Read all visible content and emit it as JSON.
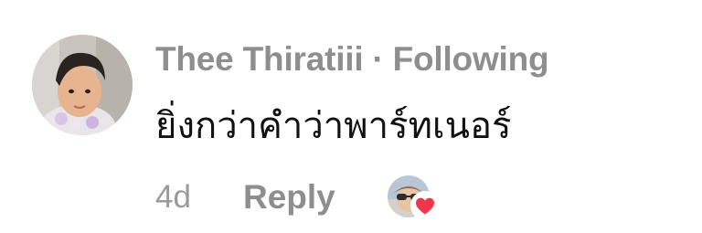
{
  "comment": {
    "author": "Thee Thiratiii",
    "separator": "·",
    "follow_status": "Following",
    "text": "ยิ่งกว่าคำว่าพาร์ทเนอร์",
    "time_ago": "4d",
    "reply_label": "Reply",
    "avatar_icon": "user-avatar-photo",
    "reaction_icon": "heart-icon",
    "reaction_color": "#f0354d"
  }
}
